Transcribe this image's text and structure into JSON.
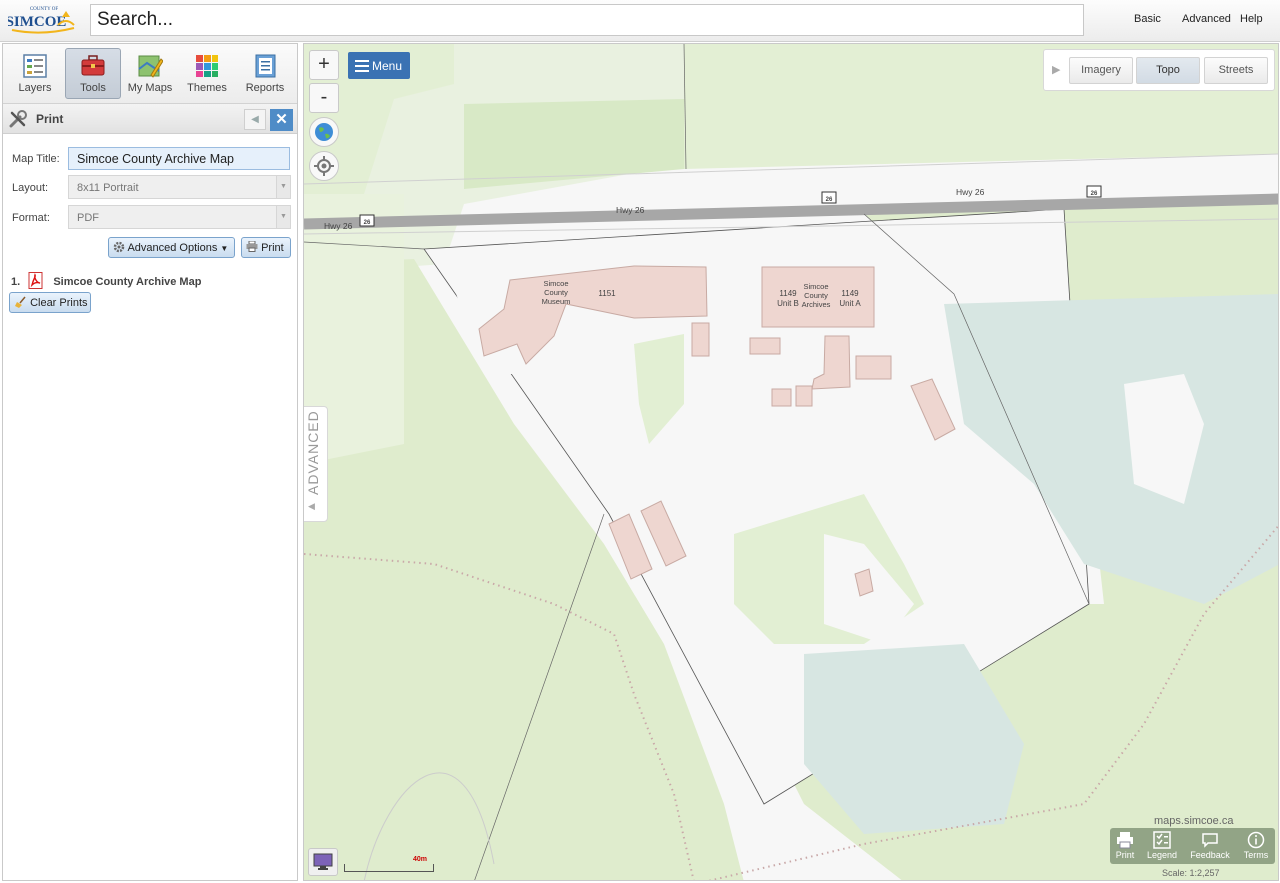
{
  "header": {
    "logo_top": "COUNTY OF",
    "logo_main": "SIMCOE",
    "search_placeholder": "Search...",
    "links": [
      "Basic",
      "Advanced",
      "Help"
    ]
  },
  "toolbar": {
    "items": [
      {
        "label": "Layers",
        "icon": "layers-icon"
      },
      {
        "label": "Tools",
        "icon": "toolbox-icon",
        "active": true
      },
      {
        "label": "My Maps",
        "icon": "my-maps-icon"
      },
      {
        "label": "Themes",
        "icon": "themes-icon"
      },
      {
        "label": "Reports",
        "icon": "reports-icon"
      }
    ]
  },
  "print_panel": {
    "title": "Print",
    "map_title_label": "Map Title:",
    "map_title_value": "Simcoe County Archive Map",
    "layout_label": "Layout:",
    "layout_value": "8x11 Portrait",
    "format_label": "Format:",
    "format_value": "PDF",
    "advanced_options_label": "Advanced Options",
    "print_label": "Print",
    "prints": [
      {
        "index": "1.",
        "name": "Simcoe County Archive Map"
      }
    ],
    "clear_prints_label": "Clear Prints"
  },
  "map": {
    "zoom_in": "+",
    "zoom_out": "-",
    "menu_label": "Menu",
    "basemaps": [
      {
        "label": "Imagery",
        "active": false
      },
      {
        "label": "Topo",
        "active": true
      },
      {
        "label": "Streets",
        "active": false
      }
    ],
    "advanced_tab": "ADVANCED",
    "road_labels": [
      "Hwy 26",
      "Hwy 26",
      "Hwy 26"
    ],
    "shield_labels": [
      "26",
      "26",
      "26"
    ],
    "building_labels": {
      "museum": [
        "Simcoe",
        "County",
        "Museum"
      ],
      "museum_number": "1151",
      "archives": [
        "Simcoe",
        "County",
        "Archives"
      ],
      "unit_b": [
        "1149",
        "Unit B"
      ],
      "unit_a": [
        "1149",
        "Unit A"
      ]
    },
    "site_url": "maps.simcoe.ca",
    "bottom_tools": [
      "Print",
      "Legend",
      "Feedback",
      "Terms"
    ],
    "scale_text": "Scale: 1:2,257",
    "scalebar_label": "40m"
  },
  "colors": {
    "accent": "#3a72b3",
    "close": "#4f8cc7",
    "green": "#dfeccd",
    "building": "#eed6d0",
    "road": "#a7a7a7"
  }
}
